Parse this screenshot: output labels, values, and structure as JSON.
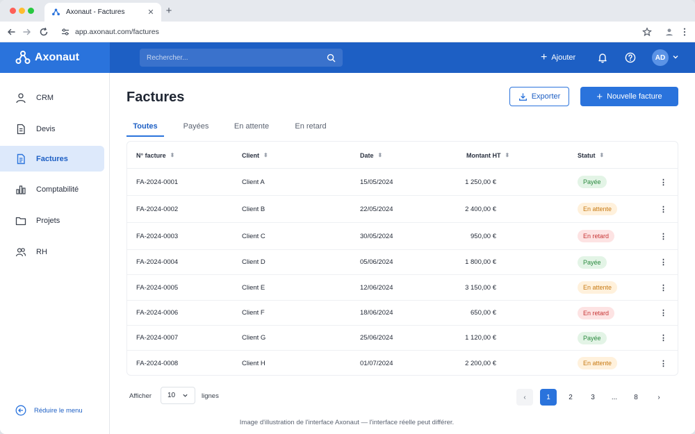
{
  "browser": {
    "tab_title": "Axonaut - Factures",
    "tab_close": "✕",
    "new_tab": "+",
    "url": "app.axonaut.com/factures"
  },
  "header": {
    "brand": "Axonaut",
    "search_placeholder": "Rechercher...",
    "add_label": "Ajouter",
    "add_plus": "+",
    "avatar_initials": "AD"
  },
  "sidebar": {
    "items": [
      {
        "label": "CRM",
        "icon": "user-icon"
      },
      {
        "label": "Devis",
        "icon": "document-icon"
      },
      {
        "label": "Factures",
        "icon": "invoice-icon"
      },
      {
        "label": "Comptabilité",
        "icon": "bar-chart-icon"
      },
      {
        "label": "Projets",
        "icon": "folder-icon"
      },
      {
        "label": "RH",
        "icon": "users-icon"
      }
    ],
    "collapse_label": "Réduire le menu"
  },
  "main": {
    "title": "Factures",
    "export_label": "Exporter",
    "new_label": "Nouvelle facture",
    "new_plus": "+",
    "tabs": [
      "Toutes",
      "Payées",
      "En attente",
      "En retard"
    ],
    "active_tab": "Toutes",
    "columns": [
      "N° facture",
      "Client",
      "Date",
      "Montant HT",
      "Statut"
    ],
    "sort_glyph": "⬍",
    "rows": [
      {
        "number": "FA-2024-0001",
        "client": "Client A",
        "date": "15/05/2024",
        "amount": "1 250,00 €",
        "status": "Payée",
        "status_type": "paid"
      },
      {
        "number": "FA-2024-0002",
        "client": "Client B",
        "date": "22/05/2024",
        "amount": "2 400,00 €",
        "status": "En attente",
        "status_type": "pending"
      },
      {
        "number": "FA-2024-0003",
        "client": "Client C",
        "date": "30/05/2024",
        "amount": "950,00 €",
        "status": "En retard",
        "status_type": "late"
      },
      {
        "number": "FA-2024-0004",
        "client": "Client D",
        "date": "05/06/2024",
        "amount": "1 800,00 €",
        "status": "Payée",
        "status_type": "paid"
      },
      {
        "number": "FA-2024-0005",
        "client": "Client E",
        "date": "12/06/2024",
        "amount": "3 150,00 €",
        "status": "En attente",
        "status_type": "pending"
      },
      {
        "number": "FA-2024-0006",
        "client": "Client F",
        "date": "18/06/2024",
        "amount": "650,00 €",
        "status": "En retard",
        "status_type": "late"
      },
      {
        "number": "FA-2024-0007",
        "client": "Client G",
        "date": "25/06/2024",
        "amount": "1 120,00 €",
        "status": "Payée",
        "status_type": "paid"
      },
      {
        "number": "FA-2024-0008",
        "client": "Client H",
        "date": "01/07/2024",
        "amount": "2 200,00 €",
        "status": "En attente",
        "status_type": "pending"
      }
    ],
    "row_menu_glyph": "⋮",
    "show_label": "Afficher",
    "rows_per_page": "10",
    "lines_label": "lignes",
    "pagination": {
      "prev": "‹",
      "pages": [
        "1",
        "2",
        "3",
        "...",
        "8"
      ],
      "current": "1",
      "next": "›"
    },
    "footnote": "Image d'illustration de l'interface Axonaut — l'interface réelle peut différer."
  },
  "colors": {
    "header_bg": "#1d5fc4",
    "brand_bg": "#2a73dc",
    "accent": "#2a73dc",
    "paid": "#2c8a40",
    "pending": "#c77a14",
    "late": "#c73535"
  }
}
